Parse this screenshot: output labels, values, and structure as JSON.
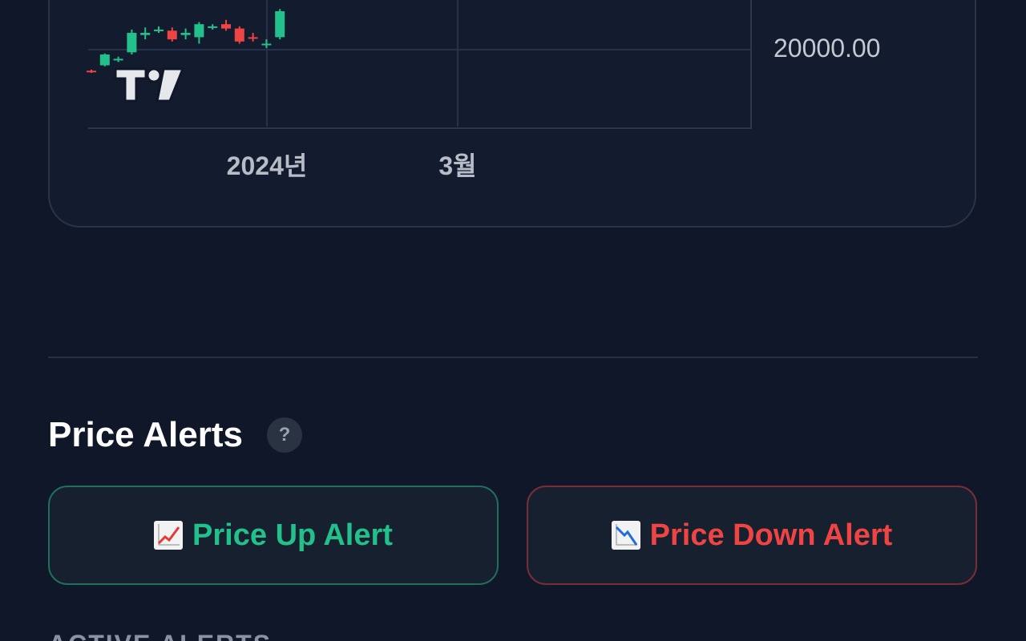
{
  "chart": {
    "price_label": "20000.00",
    "time_labels": [
      "2024년",
      "3월"
    ],
    "colors": {
      "up": "#22c08a",
      "down": "#ef4444",
      "grid": "#26324a"
    },
    "candles": [
      {
        "o": 0.96,
        "c": 0.95,
        "h": 0.97,
        "l": 0.94,
        "dir": "down"
      },
      {
        "o": 0.9,
        "c": 0.8,
        "h": 0.79,
        "l": 0.91,
        "dir": "up"
      },
      {
        "o": 0.85,
        "c": 0.84,
        "h": 0.82,
        "l": 0.87,
        "dir": "up"
      },
      {
        "o": 0.78,
        "c": 0.6,
        "h": 0.57,
        "l": 0.8,
        "dir": "up"
      },
      {
        "o": 0.62,
        "c": 0.6,
        "h": 0.55,
        "l": 0.66,
        "dir": "up"
      },
      {
        "o": 0.58,
        "c": 0.57,
        "h": 0.54,
        "l": 0.6,
        "dir": "up"
      },
      {
        "o": 0.58,
        "c": 0.66,
        "h": 0.55,
        "l": 0.68,
        "dir": "down"
      },
      {
        "o": 0.62,
        "c": 0.6,
        "h": 0.56,
        "l": 0.66,
        "dir": "up"
      },
      {
        "o": 0.64,
        "c": 0.52,
        "h": 0.5,
        "l": 0.7,
        "dir": "up"
      },
      {
        "o": 0.55,
        "c": 0.54,
        "h": 0.52,
        "l": 0.57,
        "dir": "up"
      },
      {
        "o": 0.52,
        "c": 0.56,
        "h": 0.48,
        "l": 0.58,
        "dir": "down"
      },
      {
        "o": 0.56,
        "c": 0.68,
        "h": 0.54,
        "l": 0.7,
        "dir": "down"
      },
      {
        "o": 0.65,
        "c": 0.64,
        "h": 0.6,
        "l": 0.68,
        "dir": "down"
      },
      {
        "o": 0.71,
        "c": 0.7,
        "h": 0.66,
        "l": 0.74,
        "dir": "up"
      },
      {
        "o": 0.64,
        "c": 0.4,
        "h": 0.38,
        "l": 0.66,
        "dir": "up"
      }
    ]
  },
  "alerts": {
    "title": "Price Alerts",
    "help_label": "?",
    "up_button_label": "Price Up Alert",
    "down_button_label": "Price Down Alert",
    "up_icon": "chart-increasing-icon",
    "down_icon": "chart-decreasing-icon"
  },
  "active_alerts_heading": "ACTIVE ALERTS"
}
